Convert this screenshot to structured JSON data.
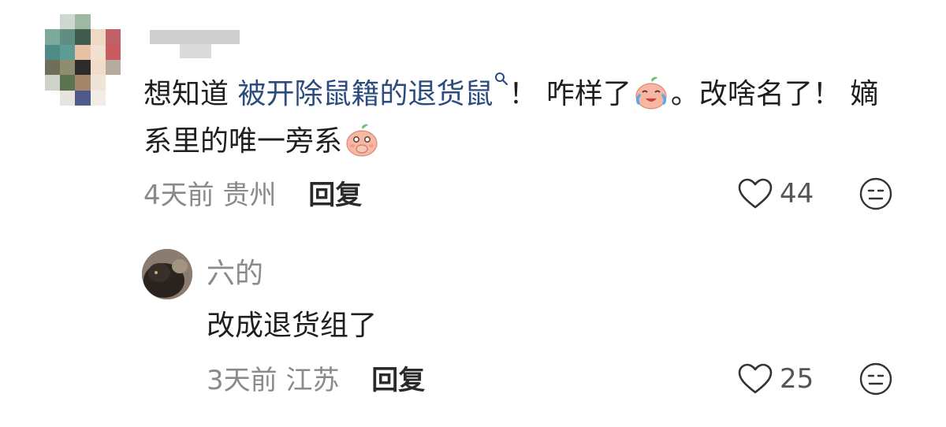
{
  "comment": {
    "text_before_link": "想知道 ",
    "link_text": "被开除鼠籍的退货鼠",
    "text_part_2": "！ 咋样了",
    "text_part_3": "。改啥名了！ 嫡系里的唯一旁系",
    "emoji_1": "crying-laughing-peach-emoji",
    "emoji_2": "covering-mouth-peach-emoji",
    "time": "4天前",
    "location": "贵州",
    "reply_label": "回复",
    "likes": "44"
  },
  "reply": {
    "username": "六的",
    "text": "改成退货组了",
    "time": "3天前",
    "location": "江苏",
    "reply_label": "回复",
    "likes": "25"
  },
  "icons": {
    "like": "heart-outline-icon",
    "dislike": "meh-face-icon",
    "search": "search-icon"
  },
  "colors": {
    "link": "#2b4c7e",
    "meta": "#8a8a8a",
    "text": "#1f1f1f"
  }
}
